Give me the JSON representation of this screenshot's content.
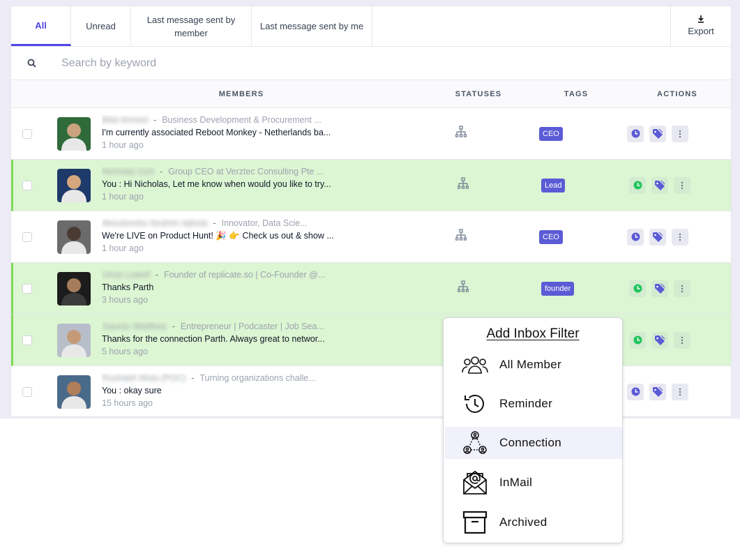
{
  "tabs": {
    "all": "All",
    "unread": "Unread",
    "last_by_member": "Last message sent by member",
    "last_by_me": "Last message sent by me",
    "export": "Export"
  },
  "search": {
    "placeholder": "Search by keyword"
  },
  "columns": {
    "members": "MEMBERS",
    "statuses": "STATUSES",
    "tags": "TAGS",
    "actions": "ACTIONS"
  },
  "rows": [
    {
      "name": "Bilal Ahmed",
      "headline": "Business Development & Procurement ...",
      "message": "I'm currently associated Reboot Monkey - Netherlands ba...",
      "time": "1 hour ago",
      "tag": "CEO",
      "highlighted": false,
      "reminder_color": "#5b5bd6"
    },
    {
      "name": "Nicholas Goh",
      "headline": "Group CEO at Verztec Consulting Pte ...",
      "message": "You : Hi Nicholas, Let me know when would you like to try...",
      "time": "1 hour ago",
      "tag": "Lead",
      "highlighted": true,
      "reminder_color": "#22c55e"
    },
    {
      "name": "Akeukereko Ibrahim Ajibola",
      "headline": "Innovator, Data Scie...",
      "message": "We're LIVE on Product Hunt! 🎉 👉 Check us out & show ...",
      "time": "1 hour ago",
      "tag": "CEO",
      "highlighted": false,
      "reminder_color": "#5b5bd6"
    },
    {
      "name": "Umar Luteef",
      "headline": "Founder of replicate.so | Co-Founder @...",
      "message": "Thanks Parth",
      "time": "3 hours ago",
      "tag": "founder",
      "highlighted": true,
      "reminder_color": "#22c55e"
    },
    {
      "name": "Gaurav Wadhwa",
      "headline": "Entrepreneur | Podcaster | Job Sea...",
      "message": "Thanks for the connection Parth. Always great to networ...",
      "time": "5 hours ago",
      "tag": "",
      "highlighted": true,
      "reminder_color": "#22c55e"
    },
    {
      "name": "Rushabh Mota (POC)",
      "headline": "Turning organizations challe...",
      "message": "You : okay sure",
      "time": "15 hours ago",
      "tag": "",
      "highlighted": false,
      "reminder_color": "#5b5bd6"
    }
  ],
  "popup": {
    "title": "Add Inbox Filter",
    "items": [
      {
        "label": "All Member",
        "icon": "group-icon"
      },
      {
        "label": "Reminder",
        "icon": "history-icon"
      },
      {
        "label": "Connection",
        "icon": "connection-icon"
      },
      {
        "label": "InMail",
        "icon": "mail-at-icon"
      },
      {
        "label": "Archived",
        "icon": "archive-box-icon"
      }
    ],
    "selected": "Connection"
  },
  "colors": {
    "accent": "#4f46e5",
    "tag": "#5b5bd6",
    "highlight": "#dcf5d2"
  }
}
